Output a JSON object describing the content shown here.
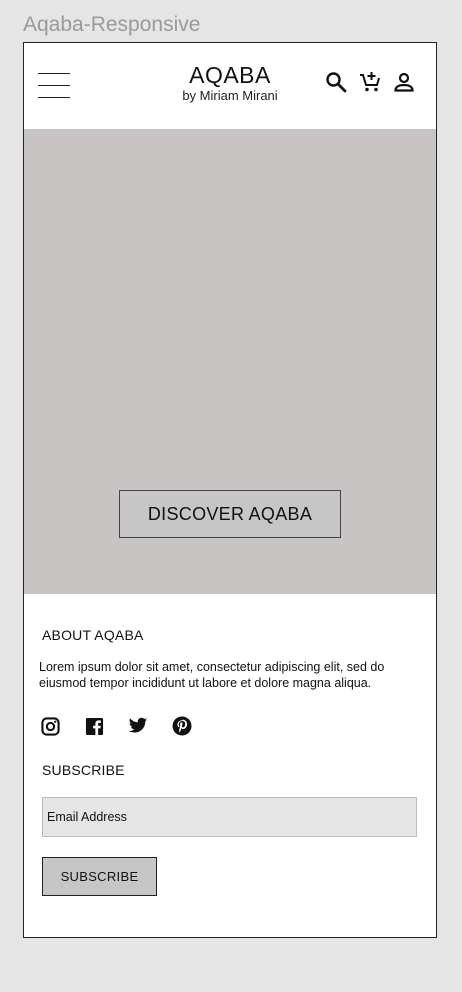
{
  "frame": {
    "title": "Aqaba-Responsive"
  },
  "header": {
    "brand_title": "AQABA",
    "brand_subtitle": "by Miriam Mirani",
    "icons": [
      "menu-icon",
      "search-icon",
      "add-to-cart-icon",
      "account-icon"
    ]
  },
  "hero": {
    "button_label": "DISCOVER AQABA",
    "background_color": "#c9c4c4"
  },
  "about": {
    "title": "ABOUT AQABA",
    "text": "Lorem ipsum dolor sit amet, consectetur adipiscing elit, sed do eiusmod tempor incididunt ut labore et dolore magna aliqua."
  },
  "social": {
    "icons": [
      "instagram-icon",
      "facebook-icon",
      "twitter-icon",
      "pinterest-icon"
    ]
  },
  "subscribe": {
    "title": "SUBSCRIBE",
    "email_placeholder": "Email Address",
    "button_label": "SUBSCRIBE"
  }
}
